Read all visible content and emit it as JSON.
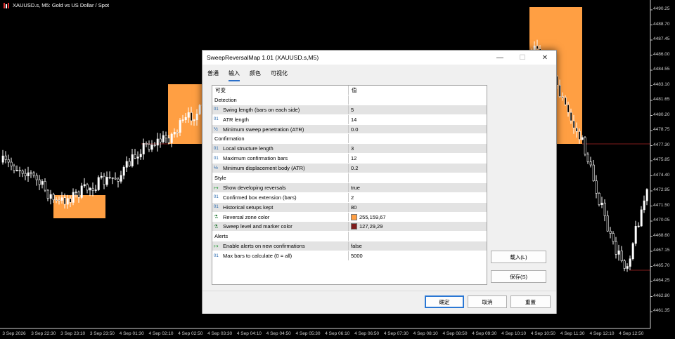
{
  "chart": {
    "title": "XAUUSD.s, M5:  Gold vs US Dollar / Spot",
    "price_labels": [
      "4490.25",
      "4488.70",
      "4487.45",
      "4486.00",
      "4484.55",
      "4483.10",
      "4481.65",
      "4480.20",
      "4478.75",
      "4477.30",
      "4475.85",
      "4474.40",
      "4472.95",
      "4471.50",
      "4470.05",
      "4468.60",
      "4467.15",
      "4465.70",
      "4464.25",
      "4462.80",
      "4461.35"
    ],
    "time_labels": [
      "3 Sep 2026",
      "3 Sep 22:30",
      "3 Sep 23:10",
      "3 Sep 23:50",
      "4 Sep 01:30",
      "4 Sep 02:10",
      "4 Sep 02:50",
      "4 Sep 03:30",
      "4 Sep 04:10",
      "4 Sep 04:50",
      "4 Sep 05:30",
      "4 Sep 06:10",
      "4 Sep 06:50",
      "4 Sep 07:30",
      "4 Sep 08:10",
      "4 Sep 08:50",
      "4 Sep 09:30",
      "4 Sep 10:10",
      "4 Sep 10:50",
      "4 Sep 11:30",
      "4 Sep 12:10",
      "4 Sep 12:50"
    ],
    "zone_color": "#ff9f43",
    "marker_color": "#7f1d1d"
  },
  "dialog": {
    "title": "SweepReversalMap 1.01 (XAUUSD.s,M5)",
    "tabs": [
      "普通",
      "输入",
      "颜色",
      "可视化"
    ],
    "active_tab": "输入",
    "col_variable": "可变",
    "col_value": "值",
    "rows": [
      {
        "type": "group",
        "label": "Detection"
      },
      {
        "type": "int",
        "label": "Swing length (bars on each side)",
        "value": "5"
      },
      {
        "type": "int",
        "label": "ATR length",
        "value": "14"
      },
      {
        "type": "dbl",
        "label": "Minimum sweep penetration (ATR)",
        "value": "0.0"
      },
      {
        "type": "group",
        "label": "Confirmation"
      },
      {
        "type": "int",
        "label": "Local structure length",
        "value": "3"
      },
      {
        "type": "int",
        "label": "Maximum confirmation bars",
        "value": "12"
      },
      {
        "type": "dbl",
        "label": "Minimum displacement body (ATR)",
        "value": "0.2"
      },
      {
        "type": "group",
        "label": "Style"
      },
      {
        "type": "bool",
        "label": "Show developing reversals",
        "value": "true"
      },
      {
        "type": "int",
        "label": "Confirmed box extension (bars)",
        "value": "2"
      },
      {
        "type": "int",
        "label": "Historical setups kept",
        "value": "80"
      },
      {
        "type": "color",
        "label": "Reversal zone color",
        "value": "255,159,67",
        "swatch": "#ff9f43"
      },
      {
        "type": "color",
        "label": "Sweep level and marker color",
        "value": "127,29,29",
        "swatch": "#7f1d1d"
      },
      {
        "type": "group",
        "label": "Alerts"
      },
      {
        "type": "bool",
        "label": "Enable alerts on new confirmations",
        "value": "false"
      },
      {
        "type": "int",
        "label": "Max bars to calculate (0 = all)",
        "value": "5000"
      }
    ],
    "icons": {
      "int": "01",
      "dbl": "½",
      "bool": "flag-icon",
      "color": "palette-icon"
    },
    "load_button": "载入(L)",
    "save_button": "保存(S)",
    "ok_button": "确定",
    "cancel_button": "取消",
    "reset_button": "重置"
  }
}
